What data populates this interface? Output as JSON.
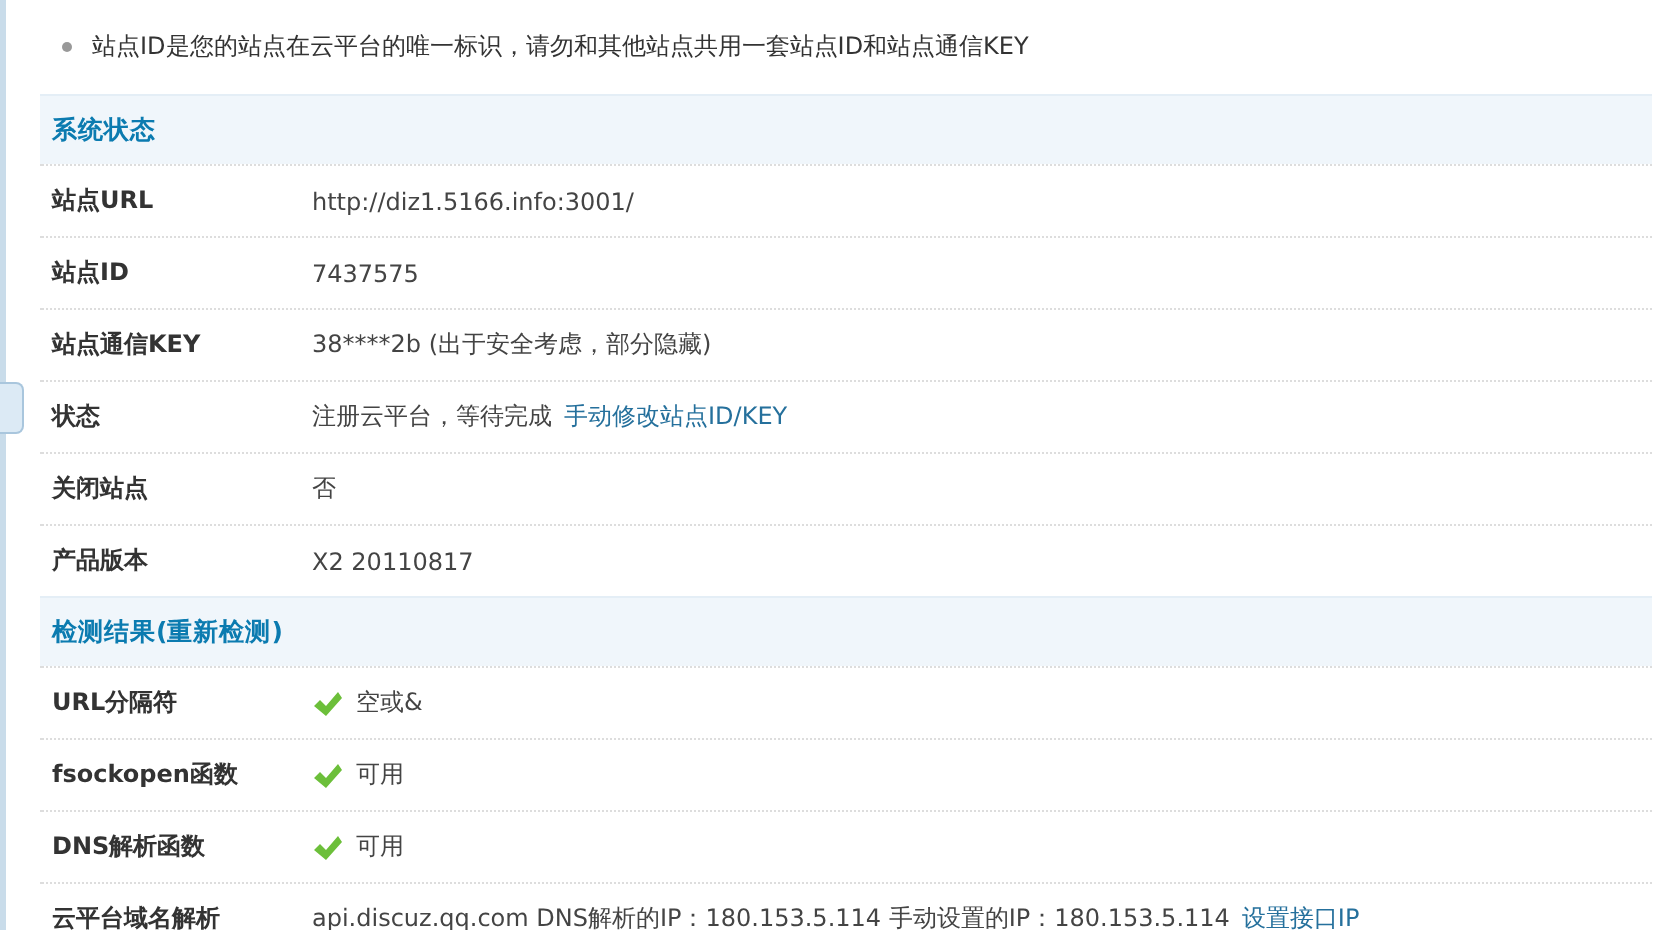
{
  "notice": "站点ID是您的站点在云平台的唯一标识，请勿和其他站点共用一套站点ID和站点通信KEY",
  "sections": [
    {
      "title": "系统状态",
      "rows": [
        {
          "label": "站点URL",
          "value": "http://diz1.5166.info:3001/"
        },
        {
          "label": "站点ID",
          "value": "7437575"
        },
        {
          "label": "站点通信KEY",
          "value": "38****2b (出于安全考虑，部分隐藏)"
        },
        {
          "label": "状态",
          "value": "注册云平台，等待完成",
          "link": "手动修改站点ID/KEY"
        },
        {
          "label": "关闭站点",
          "value": "否"
        },
        {
          "label": "产品版本",
          "value": "X2 20110817"
        }
      ]
    },
    {
      "title": "检测结果(重新检测)",
      "rows": [
        {
          "label": "URL分隔符",
          "value": "空或&",
          "ok": true
        },
        {
          "label": "fsockopen函数",
          "value": "可用",
          "ok": true
        },
        {
          "label": "DNS解析函数",
          "value": "可用",
          "ok": true
        },
        {
          "label": "云平台域名解析",
          "value": "api.discuz.qq.com DNS解析的IP：180.153.5.114 手动设置的IP：180.153.5.114",
          "link": "设置接口IP"
        }
      ]
    }
  ]
}
